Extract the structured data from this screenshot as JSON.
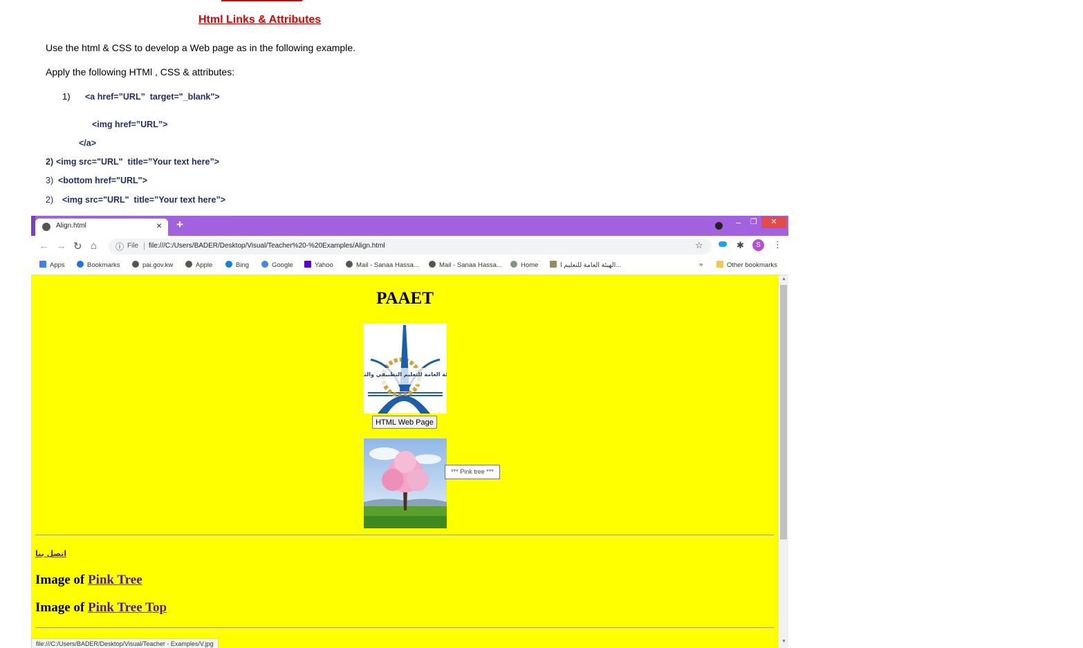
{
  "document": {
    "title": "Html Links & Attributes",
    "instruction1": "Use the html & CSS to develop a Web page as in the following example.",
    "instruction2": "Apply the following HTMl , CSS & attributes:",
    "items": [
      {
        "num": "1)",
        "code": "<a href=”URL”  target=\"_blank\">"
      },
      {
        "num": "",
        "code": "<img href=”URL”>"
      },
      {
        "num": "",
        "code": "</a>"
      },
      {
        "num": "2)",
        "code": "<img src=\"URL\"  title=”Your text here”>"
      },
      {
        "num": "3)",
        "code": "<bottom href=\"URL\">"
      },
      {
        "num": "2)",
        "code": "<img src=\"URL\"  title=”Your text here”>"
      }
    ]
  },
  "browser": {
    "tab_title": "Align.html",
    "tab_close": "×",
    "new_tab": "+",
    "minimize": "–",
    "maximize": "❐",
    "close": "✕",
    "file_label": "File",
    "url_sep": "|",
    "url": "file:///C:/Users/BADER/Desktop/Visual/Teacher%20-%20Examples/Align.html",
    "avatar_letter": "S",
    "bookmarks": [
      {
        "label": "Apps"
      },
      {
        "label": "Bookmarks"
      },
      {
        "label": "pai.gov.kw"
      },
      {
        "label": "Apple"
      },
      {
        "label": "Bing"
      },
      {
        "label": "Google"
      },
      {
        "label": "Yahoo"
      },
      {
        "label": "Mail - Sanaa Hassa..."
      },
      {
        "label": "Mail - Sanaa Hassa..."
      },
      {
        "label": "Home"
      },
      {
        "label": "الهيئة العامة للتعليم ا..."
      }
    ],
    "more_bookmarks": "»",
    "other_bookmarks": "Other bookmarks",
    "status_url": "file:///C:/Users/BADER/Desktop/Visual/Teacher - Examples/V.jpg"
  },
  "webpage": {
    "heading": "PAAET",
    "logo_arabic": "الهيئة العامة للتعليم التطبيقي والتدريب",
    "button_label": "HTML Web Page",
    "tooltip": "*** Pink tree ***",
    "contact_link": "اتصل بنا",
    "image_prefix": "Image of",
    "link1": "Pink Tree",
    "link2": "Pink Tree Top"
  },
  "colors": {
    "title_red": "#e00000",
    "code_navy": "#1f2f6b",
    "tab_bar_purple": "#a262e0",
    "page_yellow": "#ffff00",
    "link_visited": "#551a8b"
  }
}
